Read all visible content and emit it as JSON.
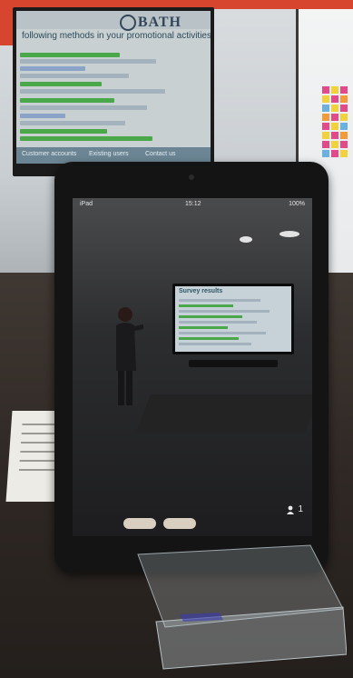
{
  "wall_display": {
    "brand": "BATH",
    "heading": "following methods in your promotional activities?",
    "footer": [
      "Customer accounts",
      "Existing users",
      "Contact us"
    ]
  },
  "tablet": {
    "status": {
      "carrier": "iPad",
      "time": "15:12",
      "battery": "100%"
    },
    "stream_title": "Survey results",
    "participant_count": "1"
  },
  "colors": {
    "accent": "#d8452e",
    "bar_green": "#4aa84a",
    "bar_blue": "#8aa3c6"
  }
}
